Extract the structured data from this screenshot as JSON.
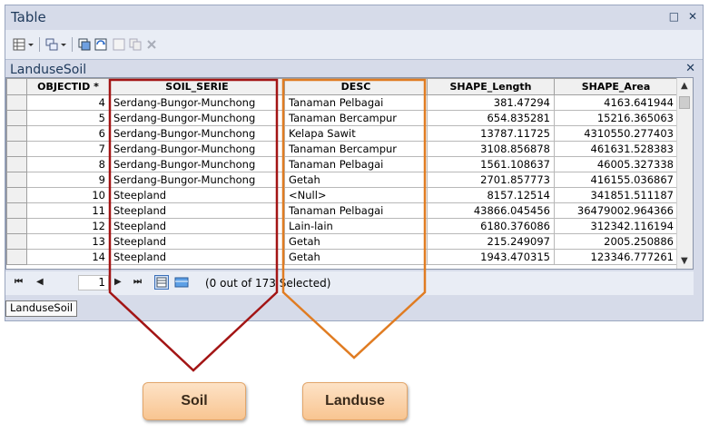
{
  "window": {
    "title": "Table",
    "ctrl_restore": "□",
    "ctrl_close": "✕"
  },
  "table_tab": {
    "name": "LanduseSoil",
    "close": "✕"
  },
  "columns": [
    "OBJECTID *",
    "SOIL_SERIE",
    "DESC",
    "SHAPE_Length",
    "SHAPE_Area"
  ],
  "rows": [
    [
      "4",
      "Serdang-Bungor-Munchong",
      "Tanaman Pelbagai",
      "381.47294",
      "4163.641944"
    ],
    [
      "5",
      "Serdang-Bungor-Munchong",
      "Tanaman Bercampur",
      "654.835281",
      "15216.365063"
    ],
    [
      "6",
      "Serdang-Bungor-Munchong",
      "Kelapa Sawit",
      "13787.11725",
      "4310550.277403"
    ],
    [
      "7",
      "Serdang-Bungor-Munchong",
      "Tanaman Bercampur",
      "3108.856878",
      "461631.528383"
    ],
    [
      "8",
      "Serdang-Bungor-Munchong",
      "Tanaman Pelbagai",
      "1561.108637",
      "46005.327338"
    ],
    [
      "9",
      "Serdang-Bungor-Munchong",
      "Getah",
      "2701.857773",
      "416155.036867"
    ],
    [
      "10",
      "Steepland",
      "<Null>",
      "8157.12514",
      "341851.511187"
    ],
    [
      "11",
      "Steepland",
      "Tanaman Pelbagai",
      "43866.045456",
      "36479002.964366"
    ],
    [
      "12",
      "Steepland",
      "Lain-lain",
      "6180.376086",
      "312342.116194"
    ],
    [
      "13",
      "Steepland",
      "Getah",
      "215.249097",
      "2005.250886"
    ],
    [
      "14",
      "Steepland",
      "Getah",
      "1943.470315",
      "123346.777261"
    ]
  ],
  "navigation": {
    "current_record": "1",
    "status": "(0 out of 173 Selected)",
    "first": "⏮",
    "prev": "◀",
    "next": "▶",
    "last": "⏭"
  },
  "bottom_tab": {
    "label": "LanduseSoil"
  },
  "annotations": {
    "soil_label": "Soil",
    "landuse_label": "Landuse",
    "soil_color": "#a31515",
    "landuse_color": "#e07c22"
  }
}
